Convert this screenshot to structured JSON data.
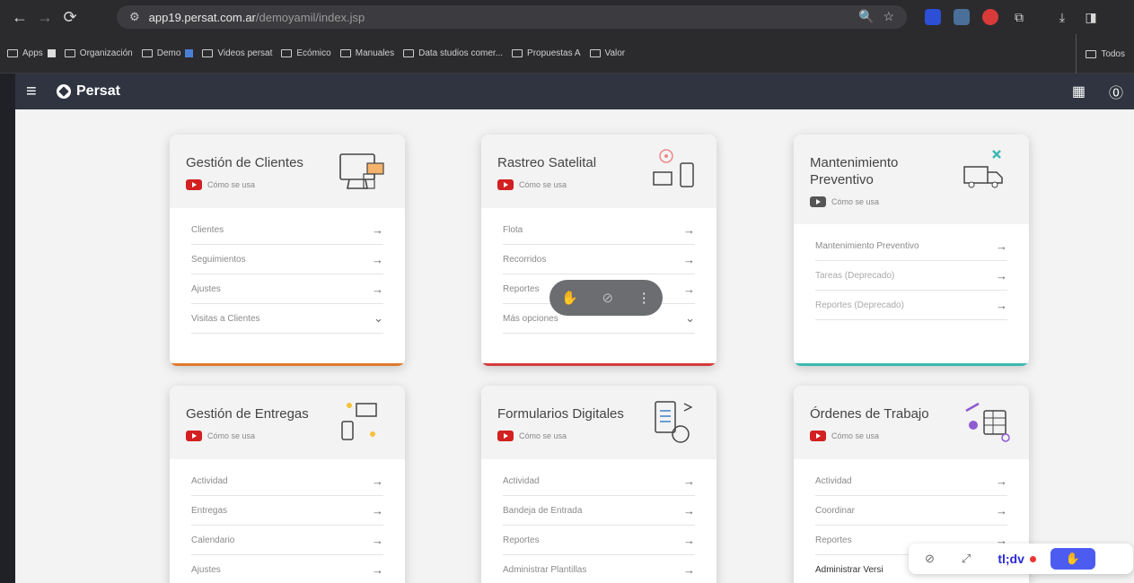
{
  "browser": {
    "url_host": "app19.persat.com.ar",
    "url_path": "/demoyamil/index.jsp",
    "bookmarks": [
      "Apps",
      "Organización",
      "Demo",
      "Videos persat",
      "Ecómico",
      "Manuales",
      "Data studios comer...",
      "Propuestas A",
      "Valor"
    ],
    "bookmarks_right": "Todos"
  },
  "header": {
    "brand": "Persat"
  },
  "howto_label": "Cómo se usa",
  "cards": [
    {
      "title": "Gestión de Clientes",
      "items": [
        "Clientes",
        "Seguimientos",
        "Ajustes",
        "Visitas a Clientes"
      ],
      "accent": "#e07a2e"
    },
    {
      "title": "Rastreo Satelital",
      "items": [
        "Flota",
        "Recorridos",
        "Reportes",
        "Más opciones"
      ],
      "accent": "#d33c3c"
    },
    {
      "title": "Mantenimiento Preventivo",
      "items": [
        "Mantenimiento Preventivo",
        "Tareas (Deprecado)",
        "Reportes (Deprecado)"
      ],
      "accent": "#3bb8b3"
    },
    {
      "title": "Gestión de Entregas",
      "items": [
        "Actividad",
        "Entregas",
        "Calendario",
        "Ajustes"
      ],
      "accent": "#e0a52e"
    },
    {
      "title": "Formularios Digitales",
      "items": [
        "Actividad",
        "Bandeja de Entrada",
        "Reportes",
        "Administrar Plantillas"
      ],
      "accent": "#6b6fd0"
    },
    {
      "title": "Órdenes de Trabajo",
      "items": [
        "Actividad",
        "Coordinar",
        "Reportes",
        "Administrar Versi"
      ],
      "accent": "#8e5ad0"
    }
  ],
  "tldv": {
    "brand": "tl;dv"
  }
}
